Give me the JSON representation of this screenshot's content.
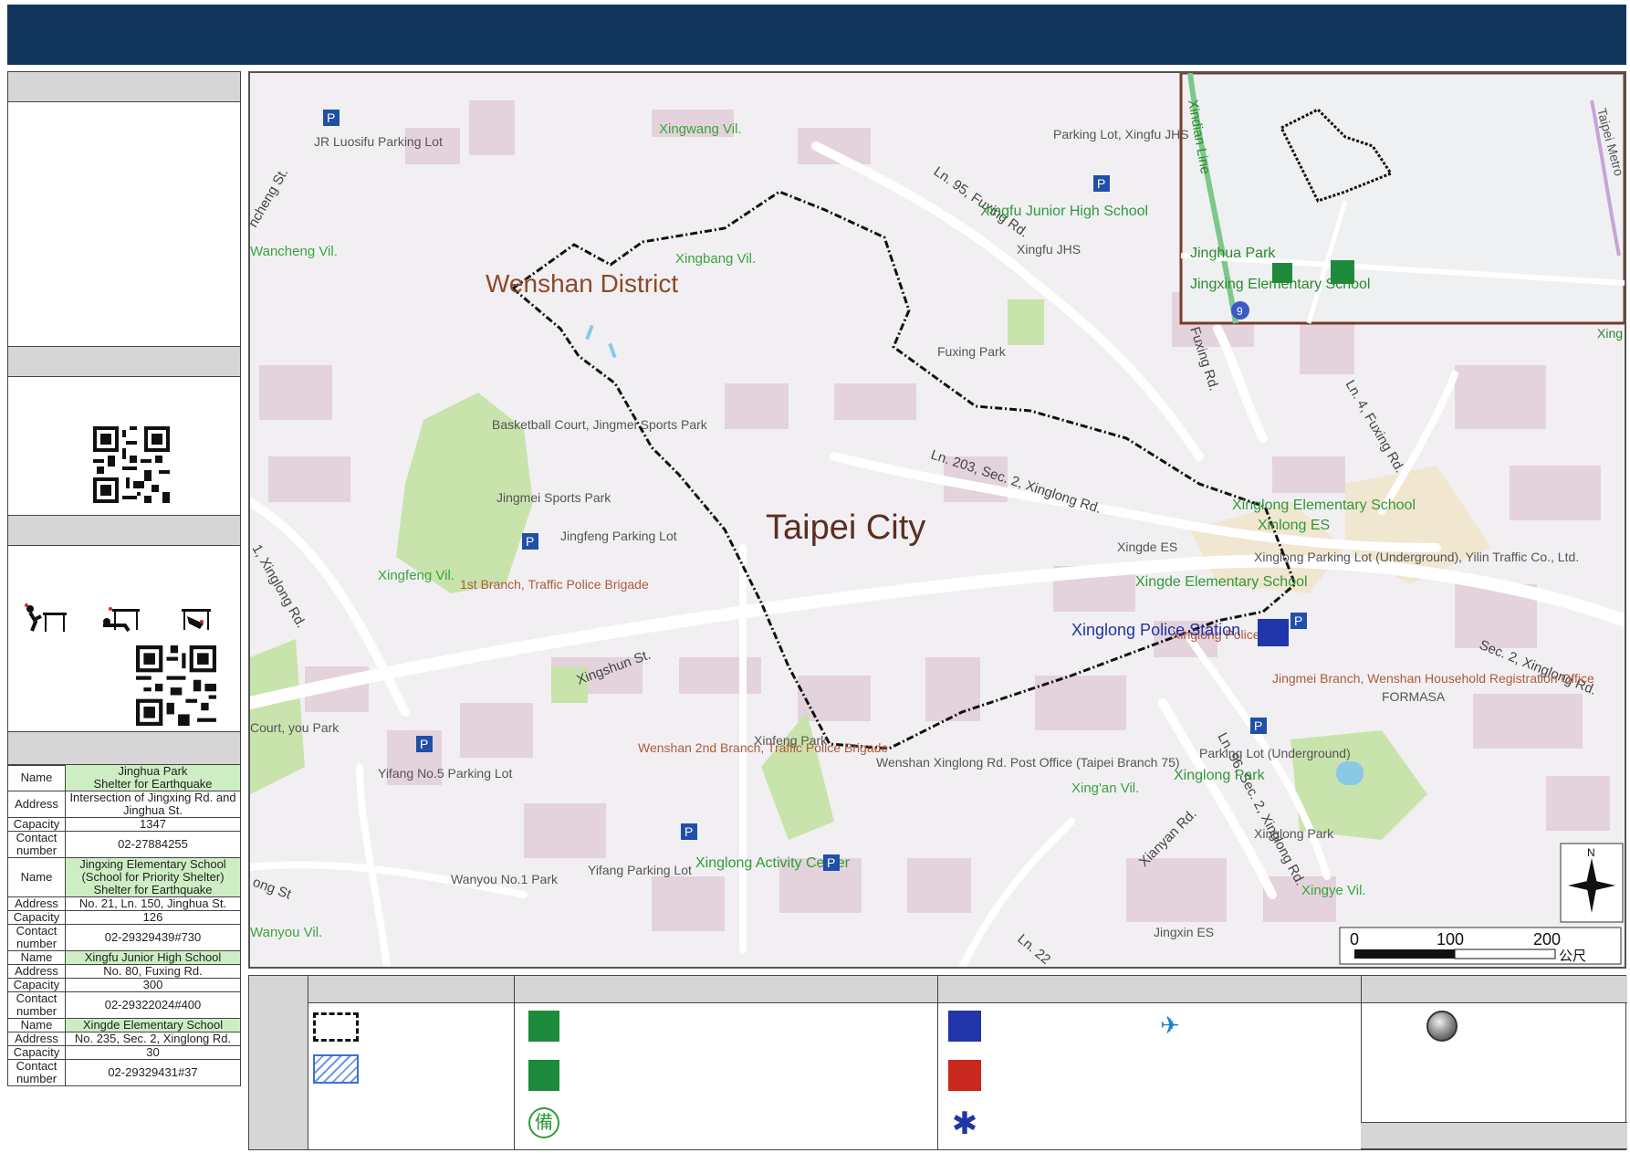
{
  "map": {
    "district_label": "Wenshan District",
    "city_label": "Taipei City",
    "villages": [
      "Xingwang Vil.",
      "Xingbang Vil.",
      "Wancheng Vil.",
      "Xingfeng Vil.",
      "Xing'an Vil.",
      "Xingye Vil.",
      "Wanyou Vil."
    ],
    "streets": [
      "Ln. 95, Fuxing Rd.",
      "Fuxing Rd.",
      "Ln. 4, Fuxing Rd.",
      "Ln. 203, Sec. 2, Xinglong Rd.",
      "Sec. 2, Xinglong Rd.",
      "Xingshun St.",
      "Ln. 96, Sec. 2, Xinglong Rd.",
      "Xianyan Rd.",
      "1, Xinglong Rd.",
      "ncheng St.",
      "ong St",
      "Ln. 22"
    ],
    "places": {
      "jr_luosifu": "JR Luosifu Parking Lot",
      "parking_xingfu": "Parking Lot, Xingfu JHS",
      "xingfu_jhs": "Xingfu Junior High School",
      "xingfu_jhs_short": "Xingfu JHS",
      "fuxing_park": "Fuxing Park",
      "basketball": "Basketball Court, Jingmei Sports Park",
      "jingmei_sports_park": "Jingmei Sports Park",
      "jingfeng_parking": "Jingfeng Parking Lot",
      "traffic_police_1": "1st Branch, Traffic Police Brigade",
      "xinglong_es": "Xinglong Elementary School",
      "xinlong_es": "Xinlong ES",
      "xingde_es_short": "Xingde ES",
      "xinglong_parking": "Xinglong Parking Lot (Underground), Yilin Traffic Co., Ltd.",
      "xingde_es": "Xingde Elementary School",
      "xinglong_police_st": "Xinglong Police Sta",
      "xinglong_police_station": "Xinglong Police Station",
      "household_reg": "Jingmei Branch, Wenshan Household Registration Office",
      "parking_underground": "Parking Lot (Underground)",
      "xinglong_park_label": "Xinglong Park",
      "xinglong_park": "Xinglong Park",
      "formasa": "FORMASA",
      "yifang5": "Yifang No.5 Parking Lot",
      "xinfeng_park": "Xinfeng Park",
      "traffic_police_2": "Wenshan 2nd Branch, Traffic Police Brigade",
      "post_office": "Wenshan Xinglong Rd. Post Office (Taipei Branch 75)",
      "yifang_parking": "Yifang Parking Lot",
      "activity_center": "Xinglong Activity Center",
      "wanyou_park": "Wanyou No.1 Park",
      "jingxin_es": "Jingxin ES",
      "court_park": "Court, you Park"
    },
    "inset": {
      "jinghua_park": "Jinghua Park",
      "jingxing_es": "Jingxing Elementary School",
      "line": "Xindian Line",
      "metro": "Taipei Metro",
      "route_num": "9",
      "edge_label": "Xing"
    },
    "scale": {
      "ticks": [
        "0",
        "100",
        "200"
      ],
      "unit": "公尺"
    },
    "north": "N"
  },
  "shelters": [
    {
      "name": "Jinghua Park\nShelter for Earthquake",
      "address": "Intersection of Jingxing Rd. and Jinghua St.",
      "capacity": "1347",
      "contact": "02-27884255"
    },
    {
      "name": "Jingxing Elementary School (School for Priority Shelter) Shelter for Earthquake",
      "address": "No. 21, Ln. 150, Jinghua St.",
      "capacity": "126",
      "contact": "02-29329439#730"
    },
    {
      "name": "Xingfu Junior High School",
      "address": "No. 80, Fuxing Rd.",
      "capacity": "300",
      "contact": "02-29322024#400"
    },
    {
      "name": "Xingde Elementary School",
      "address": "No. 235, Sec. 2, Xinglong Rd.",
      "capacity": "30",
      "contact": "02-29329431#37"
    }
  ],
  "shelter_labels": {
    "name": "Name",
    "address": "Address",
    "capacity": "Capacity",
    "contact": "Contact number"
  },
  "icons": {
    "boundary": "dashed-boundary-icon",
    "hatch": "hatched-area-icon",
    "shelter": "evacuation-shelter-icon",
    "park_shelter": "park-shelter-icon",
    "standby": "standby-shelter-icon",
    "police": "police-icon",
    "fire": "fire-department-icon",
    "medical": "medical-star-icon",
    "helicopter": "helicopter-icon",
    "point": "marker-point-icon"
  },
  "colors": {
    "header": "#12355b",
    "village_green": "#3aa43a",
    "district_brown": "#8b4a2b",
    "police_blue": "#1f35a8",
    "shelter_green": "#1d8a3c",
    "fire_red": "#c8281e"
  }
}
